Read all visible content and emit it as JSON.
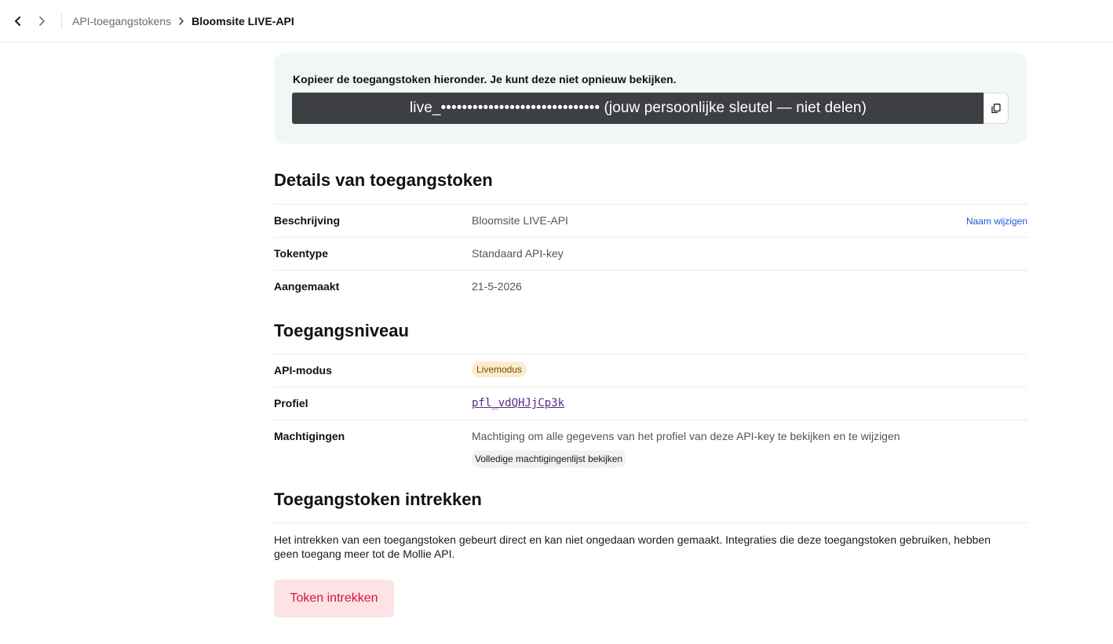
{
  "breadcrumb": {
    "parent": "API-toegangstokens",
    "current": "Bloomsite LIVE-API"
  },
  "token_card": {
    "instruction": "Kopieer de toegangstoken hieronder. Je kunt deze niet opnieuw bekijken.",
    "token_value": "live_••••••••••••••••••••••••••••••  (jouw persoonlijke sleutel — niet delen)"
  },
  "details": {
    "title": "Details van toegangstoken",
    "rows": [
      {
        "label": "Beschrijving",
        "value": "Bloomsite LIVE-API",
        "action": "Naam wijzigen"
      },
      {
        "label": "Tokentype",
        "value": "Standaard API-key"
      },
      {
        "label": "Aangemaakt",
        "value": "21-5-2026"
      }
    ]
  },
  "access": {
    "title": "Toegangsniveau",
    "api_mode_label": "API-modus",
    "api_mode_badge": "Livemodus",
    "profile_label": "Profiel",
    "profile_id": "pfl_vdQHJjCp3k",
    "permissions_label": "Machtigingen",
    "permissions_text": "Machtiging om alle gegevens van het profiel van deze API-key te bekijken en te wijzigen",
    "permissions_button": "Volledige machtigingenlijst bekijken"
  },
  "revoke": {
    "title": "Toegangstoken intrekken",
    "description": "Het intrekken van een toegangstoken gebeurt direct en kan niet ongedaan worden gemaakt. Integraties die deze toegangstoken gebruiken, hebben geen toegang meer tot de Mollie API.",
    "button": "Token intrekken"
  },
  "colors": {
    "accent_link": "#1a56db",
    "danger": "#d1173a",
    "live_badge_bg": "#fbeccd",
    "token_card_bg": "#f1f8f3"
  }
}
